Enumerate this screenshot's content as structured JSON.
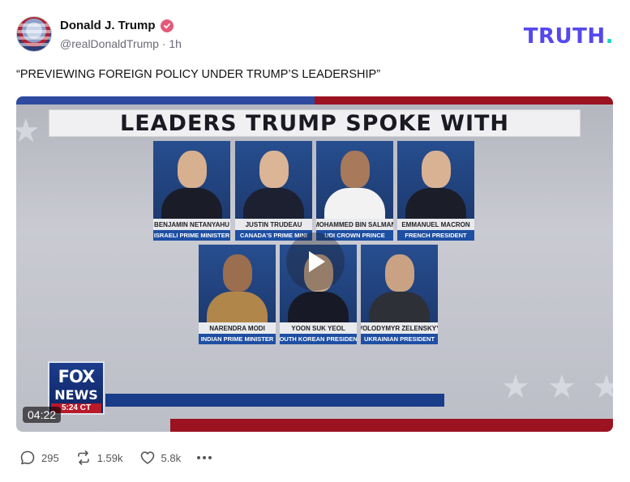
{
  "post": {
    "display_name": "Donald J. Trump",
    "handle": "@realDonaldTrump",
    "separator": "·",
    "time": "1h",
    "text": "“PREVIEWING FOREIGN POLICY UNDER TRUMP’S LEADERSHIP”"
  },
  "brand": {
    "logo_text": "TRUTH",
    "logo_dot": ".",
    "primary_color": "#5448ee",
    "accent_color": "#13d4c6"
  },
  "video": {
    "banner": "LEADERS TRUMP SPOKE WITH",
    "duration": "04:22",
    "network_line1": "FOX",
    "network_line2": "NEWS",
    "clock": "5:24 CT",
    "leaders": [
      {
        "name": "BENJAMIN NETANYAHU",
        "title": "ISRAELI PRIME MINISTER"
      },
      {
        "name": "JUSTIN TRUDEAU",
        "title": "CANADA'S PRIME MINI"
      },
      {
        "name": "MOHAMMED BIN SALMAN",
        "title": "UDI CROWN PRINCE"
      },
      {
        "name": "EMMANUEL MACRON",
        "title": "FRENCH PRESIDENT"
      },
      {
        "name": "NARENDRA MODI",
        "title": "INDIAN PRIME MINISTER"
      },
      {
        "name": "YOON SUK YEOL",
        "title": "SOUTH KOREAN PRESIDENT"
      },
      {
        "name": "VOLODYMYR ZELENSKYY",
        "title": "UKRAINIAN PRESIDENT"
      }
    ]
  },
  "actions": {
    "replies": "295",
    "retruths": "1.59k",
    "likes": "5.8k"
  }
}
